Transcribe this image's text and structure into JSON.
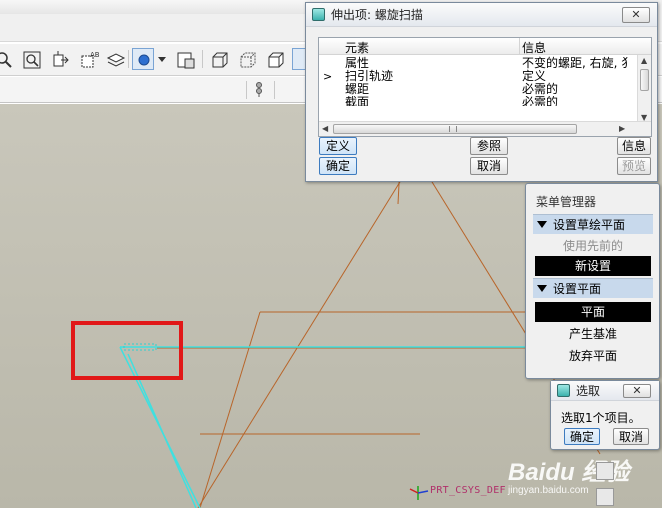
{
  "colors": {
    "accent": "#3d7bbf",
    "model_lines": "#b8652a",
    "highlight_lines": "#3fe0e0",
    "annotation_red": "#e11818",
    "canvas_bg": "#c3c1b4"
  },
  "toolbar": {
    "icons": [
      "zoom-icon",
      "zoom-window-icon",
      "reorient-icon",
      "named-views-icon",
      "layers-icon",
      "appearance-icon",
      "render-icon",
      "display-style-icon"
    ]
  },
  "sweep_dialog": {
    "title": "伸出项: 螺旋扫描",
    "close_label": "✕",
    "columns": [
      "元素",
      "信息"
    ],
    "rows": [
      {
        "element": "属性",
        "info": "不变的螺距, 右旋, 犭",
        "marker": ""
      },
      {
        "element": "扫引轨迹",
        "info": "定义",
        "marker": ">"
      },
      {
        "element": "螺距",
        "info": "必需的",
        "marker": ""
      },
      {
        "element": "截面",
        "info": "必需的",
        "marker": ""
      }
    ],
    "buttons": {
      "define": "定义",
      "refs": "参照",
      "info": "信息",
      "ok": "确定",
      "cancel": "取消",
      "preview": "预览"
    }
  },
  "menu_manager": {
    "title": "菜单管理器",
    "section1": "设置草绘平面",
    "section1_items": [
      {
        "label": "使用先前的",
        "state": "disabled"
      },
      {
        "label": "新设置",
        "state": "selected"
      }
    ],
    "section2": "设置平面",
    "section2_items": [
      {
        "label": "平面",
        "state": "selected"
      },
      {
        "label": "产生基准",
        "state": "normal"
      },
      {
        "label": "放弃平面",
        "state": "normal"
      }
    ]
  },
  "select_dialog": {
    "title": "选取",
    "close_label": "✕",
    "message": "选取1个项目。",
    "ok": "确定",
    "cancel": "取消"
  },
  "canvas": {
    "csys_label": "PRT_CSYS_DEF",
    "watermark_line1": "Baidu 经验",
    "watermark_line2": "jingyan.baidu.com"
  }
}
